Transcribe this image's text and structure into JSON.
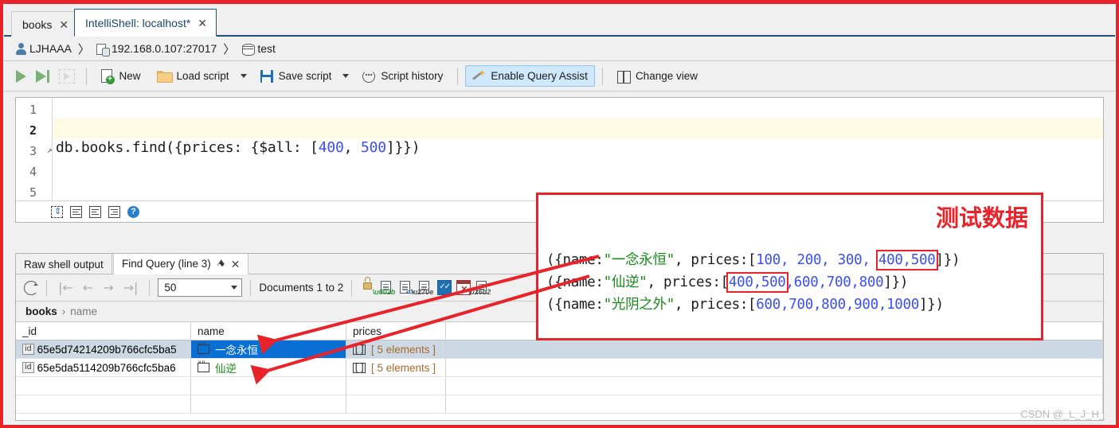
{
  "window": {
    "tabs": [
      {
        "label": "books",
        "active": false,
        "close": "✕"
      },
      {
        "label": "IntelliShell: localhost*",
        "active": true,
        "close": "✕"
      }
    ]
  },
  "connection": {
    "user": "LJHAAA",
    "sep1": "〉",
    "server": "192.168.0.107:27017",
    "sep2": "〉",
    "database": "test"
  },
  "toolbar": {
    "run_label": "",
    "new_label": "New",
    "load_script_label": "Load script",
    "save_script_label": "Save script",
    "script_history_label": "Script history",
    "query_assist_label": "Enable Query Assist",
    "change_view_label": "Change view"
  },
  "editor": {
    "line_numbers": [
      "1",
      "2",
      "3",
      "4",
      "5"
    ],
    "current_line": "3",
    "fold_marker": "↗",
    "code": {
      "prefix": "db.books.find({prices: {$all: [",
      "num1": "400",
      "mid": ", ",
      "num2": "500",
      "suffix": "]}})"
    },
    "footer_help": "?"
  },
  "results": {
    "tabs": [
      {
        "label": "Raw shell output",
        "active": false
      },
      {
        "label": "Find Query (line 3)",
        "active": true,
        "pin": "⚑",
        "close": "✕"
      }
    ],
    "page_size": "50",
    "document_range": "Documents 1 to 2",
    "breadcrumb": {
      "collection": "books",
      "separator": "›",
      "field": "name"
    },
    "nav": {
      "first": "|←",
      "prev": "←",
      "next": "→",
      "last": "→|"
    },
    "columns": [
      "_id",
      "name",
      "prices"
    ],
    "rows": [
      {
        "id_badge": "id",
        "id": "65e5d74214209b766cfc5ba5",
        "name": "一念永恒",
        "prices": "[ 5 elements ]",
        "prices_badge": "[]",
        "selected": true
      },
      {
        "id_badge": "id",
        "id": "65e5da5114209b766cfc5ba6",
        "name": "仙逆",
        "prices": "[ 5 elements ]",
        "prices_badge": "[]",
        "selected": false
      }
    ]
  },
  "annotation": {
    "title": "测试数据",
    "lines": [
      {
        "p1": "({name:",
        "name": "\"一念永恒\"",
        "p2": ", prices:[",
        "nums_plain": "100, 200, 300, ",
        "nums_highlight": "400,500",
        "p3": "]})"
      },
      {
        "p1": "({name:",
        "name": "\"仙逆\"",
        "p2": ", prices:[",
        "nums_highlight": "400,500",
        "nums_plain": ",600,700,800",
        "p3": "]})"
      },
      {
        "p1": "({name:",
        "name": "\"光阴之外\"",
        "p2": ", prices:[",
        "nums_plain": "600,700,800,900,1000",
        "p3": "]})"
      }
    ],
    "accent_color": "#e8232a"
  },
  "watermark": "CSDN @_L_J_H_"
}
